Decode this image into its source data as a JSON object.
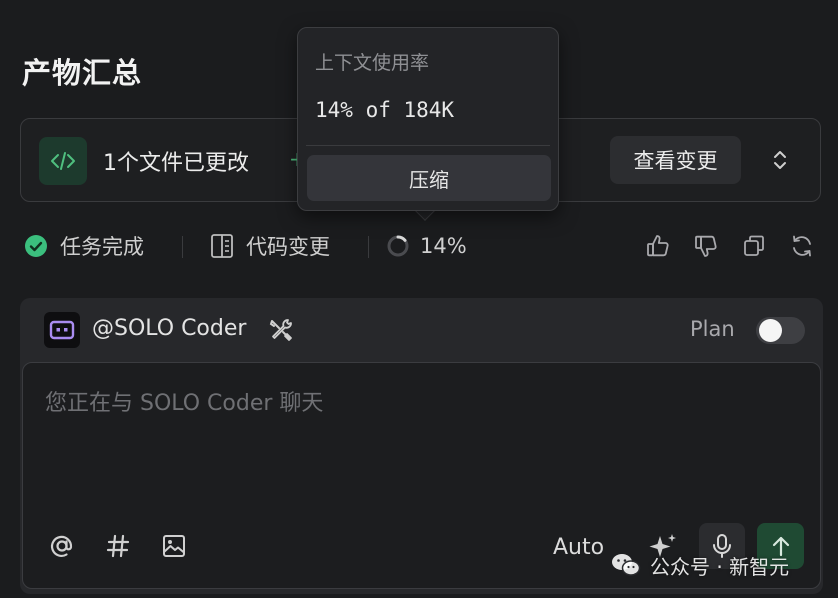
{
  "page": {
    "title": "产物汇总"
  },
  "changes": {
    "summary": "1个文件已更改",
    "tail": "+",
    "view_label": "查看变更",
    "badge_icon": "code-icon",
    "accent": "#4fbf7f"
  },
  "status": {
    "task_label": "任务完成",
    "code_changes_label": "代码变更",
    "context_percent": "14%",
    "context_fraction": 0.14
  },
  "context_popover": {
    "title": "上下文使用率",
    "usage": "14% of 184K",
    "compress_label": "压缩"
  },
  "chat": {
    "agent_name": "@SOLO Coder",
    "plan_label": "Plan",
    "plan_enabled": false,
    "input_placeholder": "您正在与 SOLO Coder 聊天",
    "input_value": "",
    "model_label": "Auto"
  },
  "watermark": {
    "text": "公众号 · 新智元"
  }
}
